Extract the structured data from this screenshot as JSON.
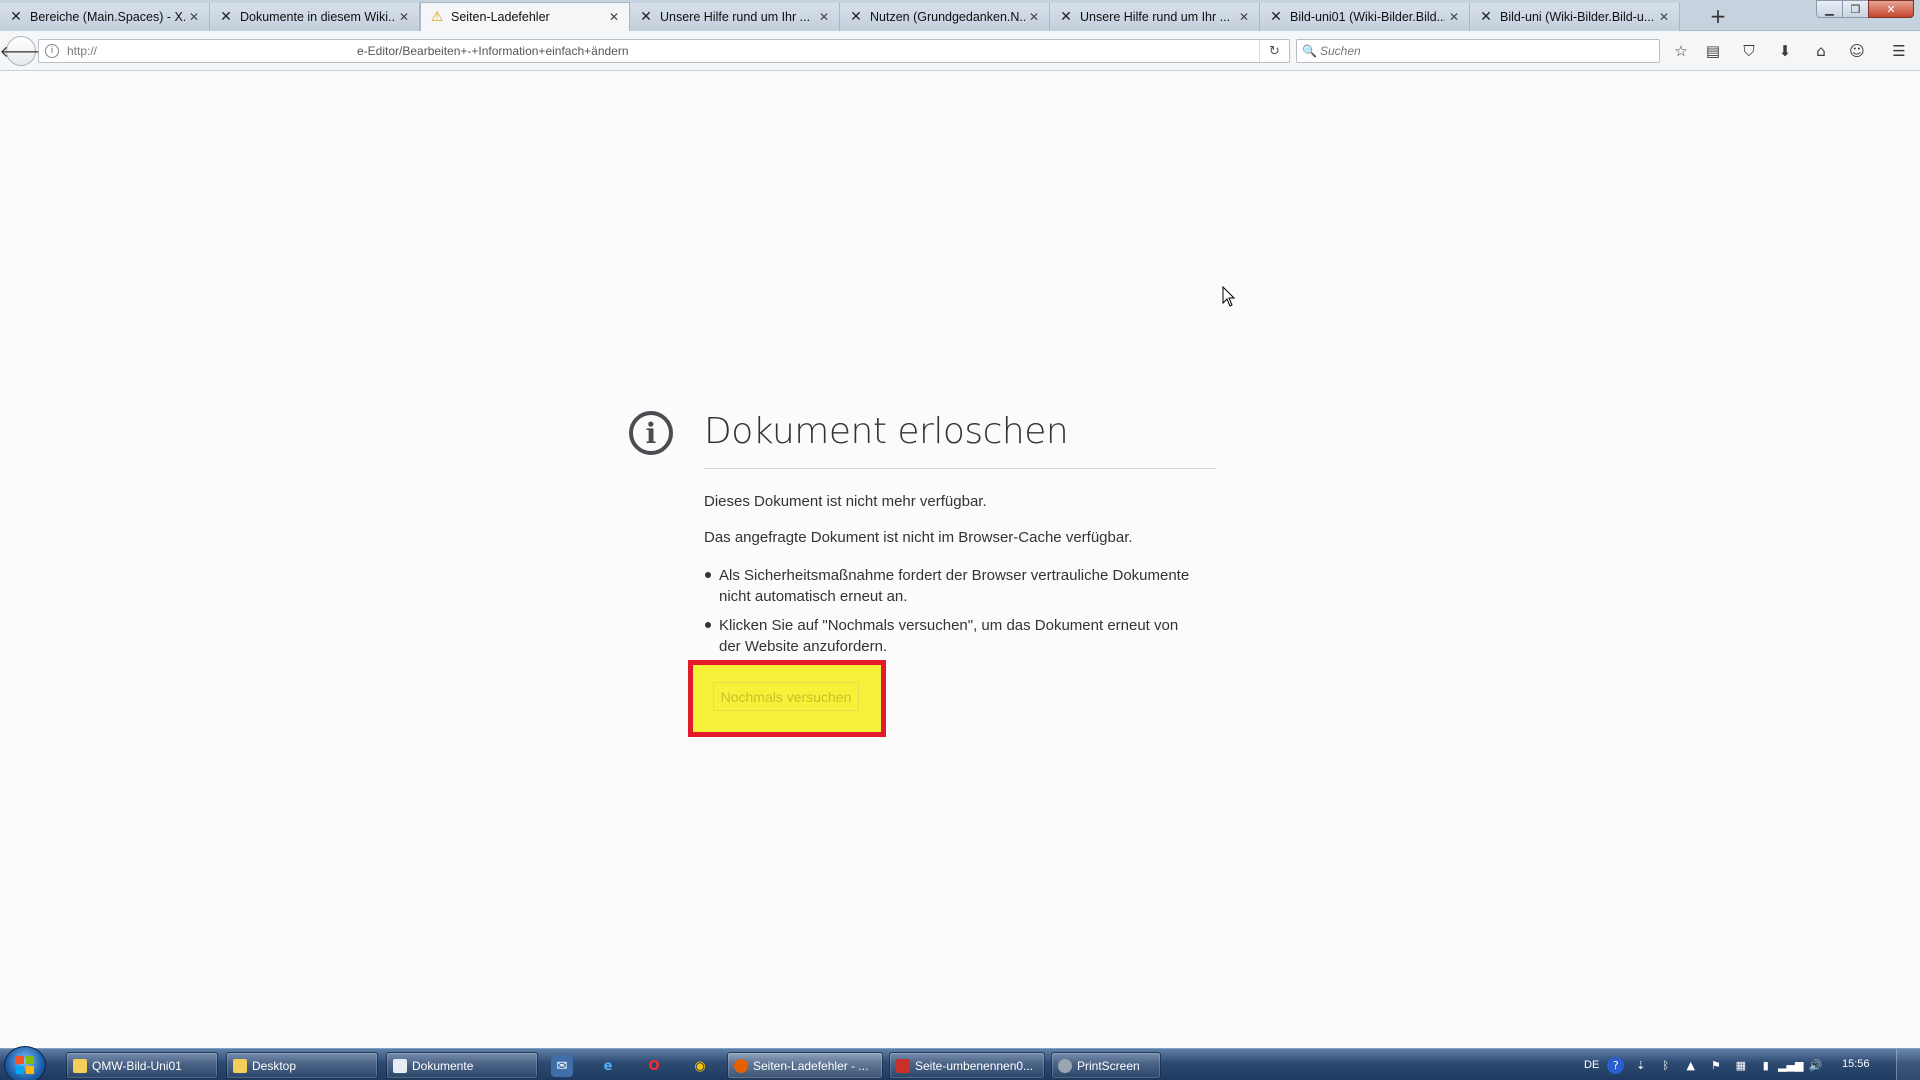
{
  "browser": {
    "tabs": [
      {
        "label": "Bereiche (Main.Spaces) - X...",
        "icon": "xwiki-icon",
        "active": false
      },
      {
        "label": "Dokumente in diesem Wiki...",
        "icon": "xwiki-icon",
        "active": false
      },
      {
        "label": "Seiten-Ladefehler",
        "icon": "warning-icon",
        "active": true
      },
      {
        "label": "Unsere Hilfe rund um Ihr ...",
        "icon": "xwiki-icon",
        "active": false
      },
      {
        "label": "Nutzen (Grundgedanken.N...",
        "icon": "xwiki-icon",
        "active": false
      },
      {
        "label": "Unsere Hilfe rund um Ihr ...",
        "icon": "xwiki-icon",
        "active": false
      },
      {
        "label": "Bild-uni01 (Wiki-Bilder.Bild...",
        "icon": "xwiki-icon",
        "active": false
      },
      {
        "label": "Bild-uni (Wiki-Bilder.Bild-u...",
        "icon": "xwiki-icon",
        "active": false
      }
    ],
    "url_start": "http://",
    "url_rest": "e-Editor/Bearbeiten+-+Information+einfach+ändern",
    "search_placeholder": "Suchen"
  },
  "error": {
    "title": "Dokument erloschen",
    "short_desc": "Dieses Dokument ist nicht mehr verfügbar.",
    "long_desc": "Das angefragte Dokument ist nicht im Browser-Cache verfügbar.",
    "bullets": [
      "Als Sicherheitsmaßnahme fordert der Browser vertrauliche Dokumente nicht automatisch erneut an.",
      "Klicken Sie auf \"Nochmals versuchen\", um das Dokument erneut von der Website anzufordern."
    ],
    "retry_label": "Nochmals versuchen",
    "highlight_color": "#f6f23a",
    "highlight_border": "#e21a2c"
  },
  "taskbar": {
    "tasks": [
      {
        "label": "QMW-Bild-Uni01",
        "icon": "folder-icon"
      },
      {
        "label": "Desktop",
        "icon": "folder-icon"
      },
      {
        "label": "Dokumente",
        "icon": "document-icon"
      },
      {
        "label": "Seiten-Ladefehler - ...",
        "icon": "firefox-icon",
        "active": true
      },
      {
        "label": "Seite-umbenennen0...",
        "icon": "paint-icon"
      },
      {
        "label": "PrintScreen",
        "icon": "camera-icon"
      }
    ],
    "language": "DE",
    "clock": "15:56"
  }
}
